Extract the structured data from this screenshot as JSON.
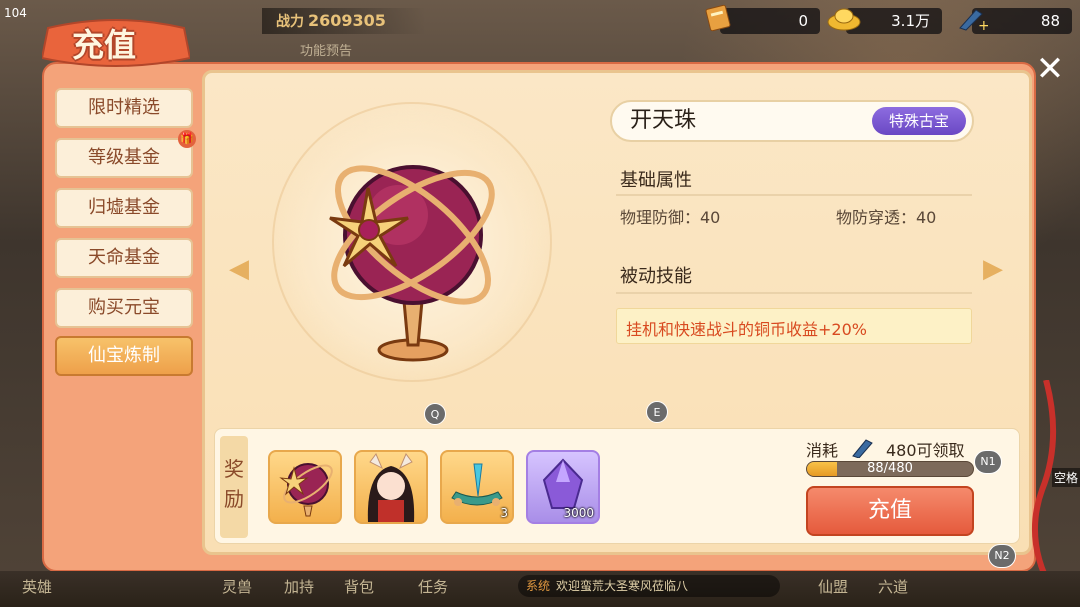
{
  "header": {
    "title": "充值",
    "power_value": "2609305",
    "sub_label": "功能预告",
    "level": "104"
  },
  "resources": [
    {
      "name": "ticket-icon",
      "value": "0"
    },
    {
      "name": "gold-ingot-icon",
      "value": "3.1万"
    },
    {
      "name": "spirit-blade-icon",
      "value": "88"
    }
  ],
  "tabs": [
    {
      "label": "限时精选",
      "active": false
    },
    {
      "label": "等级基金",
      "active": false
    },
    {
      "label": "归墟基金",
      "active": false
    },
    {
      "label": "天命基金",
      "active": false
    },
    {
      "label": "购买元宝",
      "active": false
    },
    {
      "label": "仙宝炼制",
      "active": true
    }
  ],
  "item": {
    "name": "开天珠",
    "type": "特殊古宝",
    "basic_title": "基础属性",
    "attrs": [
      {
        "text": "物理防御：40"
      },
      {
        "text": "物防穿透：40"
      }
    ],
    "passive_title": "被动技能",
    "passive_desc": "挂机和快速战斗的铜币收益+20%"
  },
  "key_hints": {
    "q": "Q",
    "e": "E",
    "n1": "N1",
    "n2": "N2",
    "space": "空格"
  },
  "rewards": {
    "label": "奖励",
    "items": [
      {
        "icon": "celestial-orb-icon",
        "count": ""
      },
      {
        "icon": "fox-girl-avatar",
        "count": ""
      },
      {
        "icon": "jade-boat-icon",
        "count": "3"
      },
      {
        "icon": "purple-crystal-icon",
        "count": "3000"
      }
    ]
  },
  "cost": {
    "label": "消耗",
    "claim_text": "480可领取",
    "progress_text": "88/480",
    "progress_fraction": 0.1833
  },
  "charge_button": "充值",
  "bottom": {
    "nav": [
      "英雄",
      "灵兽",
      "加持",
      "背包",
      "任务",
      "仙盟",
      "六道"
    ],
    "msg_tag": "系统",
    "msg_text": "欢迎蛮荒大圣寒风莅临八"
  },
  "colors": {
    "accent": "#e55a3c",
    "panel": "#fbe7c6",
    "purple": "#6a48c4",
    "skill_text": "#d84a20"
  }
}
